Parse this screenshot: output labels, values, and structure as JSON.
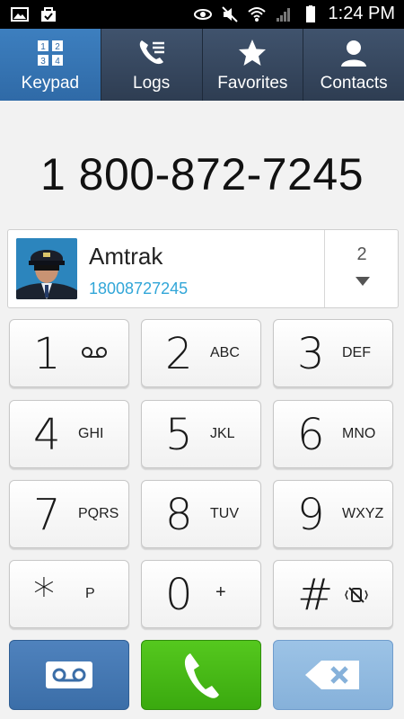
{
  "status_bar": {
    "time": "1:24 PM"
  },
  "tabs": [
    {
      "label": "Keypad",
      "active": true
    },
    {
      "label": "Logs",
      "active": false
    },
    {
      "label": "Favorites",
      "active": false
    },
    {
      "label": "Contacts",
      "active": false
    }
  ],
  "dialed_number": "1 800-872-7245",
  "suggestion": {
    "name": "Amtrak",
    "number": "18008727245",
    "match_count": "2"
  },
  "keypad": [
    {
      "digit": "1",
      "letters": ""
    },
    {
      "digit": "2",
      "letters": "ABC"
    },
    {
      "digit": "3",
      "letters": "DEF"
    },
    {
      "digit": "4",
      "letters": "GHI"
    },
    {
      "digit": "5",
      "letters": "JKL"
    },
    {
      "digit": "6",
      "letters": "MNO"
    },
    {
      "digit": "7",
      "letters": "PQRS"
    },
    {
      "digit": "8",
      "letters": "TUV"
    },
    {
      "digit": "9",
      "letters": "WXYZ"
    },
    {
      "digit": "*",
      "letters": "P"
    },
    {
      "digit": "0",
      "letters": "+"
    },
    {
      "digit": "#",
      "letters": ""
    }
  ],
  "colors": {
    "accent_tab": "#3d7fbf",
    "call_green": "#45b815",
    "link_blue": "#31a6d8"
  }
}
